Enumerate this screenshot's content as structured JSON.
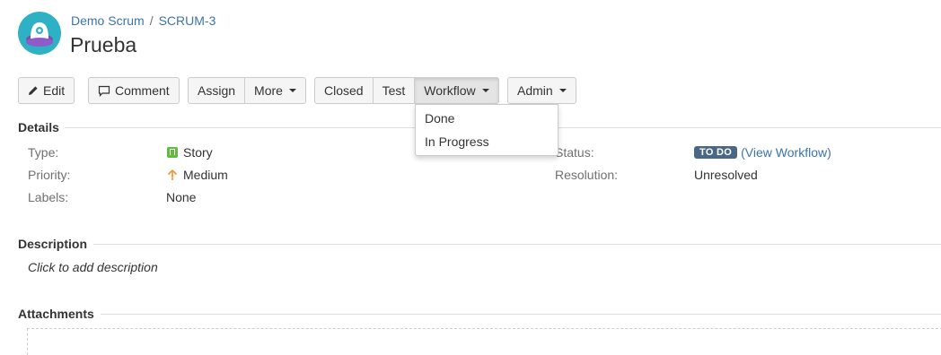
{
  "header": {
    "breadcrumb": {
      "project": "Demo Scrum",
      "separator": "/",
      "issue_key": "SCRUM-3"
    },
    "title": "Prueba"
  },
  "toolbar": {
    "edit": "Edit",
    "comment": "Comment",
    "assign": "Assign",
    "more": "More",
    "closed": "Closed",
    "test": "Test",
    "workflow": "Workflow",
    "admin": "Admin"
  },
  "workflow_menu": {
    "items": [
      "Done",
      "In Progress"
    ]
  },
  "details": {
    "heading": "Details",
    "type_label": "Type:",
    "type_value": "Story",
    "priority_label": "Priority:",
    "priority_value": "Medium",
    "labels_label": "Labels:",
    "labels_value": "None",
    "status_label": "Status:",
    "status_value": "TO DO",
    "view_workflow": "(View Workflow)",
    "resolution_label": "Resolution:",
    "resolution_value": "Unresolved"
  },
  "description": {
    "heading": "Description",
    "placeholder": "Click to add description"
  },
  "attachments": {
    "heading": "Attachments"
  },
  "colors": {
    "link": "#3b73af",
    "status_badge": "#4a6785",
    "story_icon": "#63ba3c",
    "priority_arrow": "#f79232"
  }
}
